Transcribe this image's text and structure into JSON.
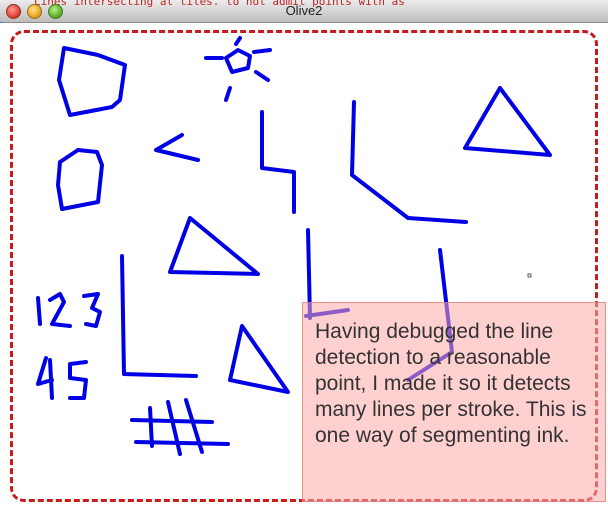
{
  "window": {
    "title": "Olive2",
    "background_text": "Lines intersecting at tiles. to not admit points with as"
  },
  "caption": {
    "text": "Having debugged the line detection to a reasonable point, I made it so it detects many lines per stroke. This is one way of segmenting ink."
  },
  "colors": {
    "stroke": "#0000e6",
    "border": "#c81c1c",
    "caption_bg": "#ffaaaa"
  }
}
